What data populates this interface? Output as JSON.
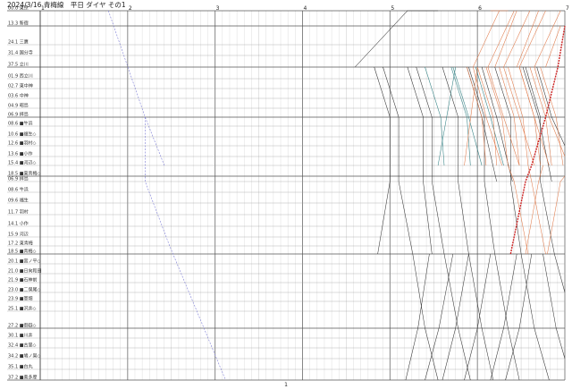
{
  "header": {
    "date": "2024/3/16",
    "line": "青梅線",
    "day_type": "平日",
    "kind": "ダイヤ",
    "part": "その1"
  },
  "hours": [
    "1",
    "2",
    "3",
    "4",
    "5",
    "6",
    "7"
  ],
  "footer_page": "1",
  "stations": [
    {
      "km": "00.0",
      "name": "東京",
      "major": true
    },
    {
      "km": "13.3",
      "name": "新宿",
      "major": true
    },
    {
      "km": "24.1",
      "name": "三鷹",
      "major": false
    },
    {
      "km": "31.4",
      "name": "国分寺",
      "major": false
    },
    {
      "km": "37.5",
      "name": "立川",
      "major": true
    },
    {
      "km": "01.9",
      "name": "西立川",
      "major": false
    },
    {
      "km": "02.7",
      "name": "東中神",
      "major": false
    },
    {
      "km": "03.6",
      "name": "中神",
      "major": false
    },
    {
      "km": "04.9",
      "name": "昭島",
      "major": false
    },
    {
      "km": "06.9",
      "name": "拝島",
      "major": true
    },
    {
      "km": "08.6",
      "name": "■牛浜",
      "major": false
    },
    {
      "km": "10.6",
      "name": "■福生◇",
      "major": false
    },
    {
      "km": "12.6",
      "name": "■羽村◇",
      "major": false
    },
    {
      "km": "13.6",
      "name": "■小作",
      "major": false
    },
    {
      "km": "15.4",
      "name": "■河辺◇",
      "major": false
    },
    {
      "km": "18.5",
      "name": "■東青梅◇",
      "major": true
    },
    {
      "km": "06.9",
      "name": "拝島",
      "major": false
    },
    {
      "km": "08.6",
      "name": "牛浜",
      "major": false
    },
    {
      "km": "09.6",
      "name": "福生",
      "major": false
    },
    {
      "km": "11.7",
      "name": "羽村",
      "major": false
    },
    {
      "km": "14.1",
      "name": "小作",
      "major": false
    },
    {
      "km": "15.9",
      "name": "河辺",
      "major": false
    },
    {
      "km": "17.2",
      "name": "東青梅",
      "major": false
    },
    {
      "km": "18.5",
      "name": "■青梅◇",
      "major": true
    },
    {
      "km": "20.1",
      "name": "■宮ノ平◇",
      "major": false
    },
    {
      "km": "21.0",
      "name": "■日向和田",
      "major": false
    },
    {
      "km": "21.9",
      "name": "■石神前",
      "major": false
    },
    {
      "km": "23.0",
      "name": "■二俣尾◇",
      "major": false
    },
    {
      "km": "23.9",
      "name": "■軍畑",
      "major": false
    },
    {
      "km": "25.1",
      "name": "■沢井◇",
      "major": false
    },
    {
      "km": "27.2",
      "name": "■御嶽◇",
      "major": true
    },
    {
      "km": "30.1",
      "name": "■川井",
      "major": false
    },
    {
      "km": "32.4",
      "name": "■古里◇",
      "major": false
    },
    {
      "km": "34.2",
      "name": "■鳩ノ巣◇",
      "major": false
    },
    {
      "km": "35.1",
      "name": "■白丸",
      "major": false
    },
    {
      "km": "37.2",
      "name": "■奥多摩",
      "major": true
    }
  ],
  "colors": {
    "grid_minor": "#c8c8c8",
    "grid_major": "#7a7a7a",
    "local_train": "#333333",
    "rapid_train": "#2f7f82",
    "express_train": "#e07a4a",
    "freight_train": "#7c7cd4",
    "special_train": "#cc2222"
  }
}
